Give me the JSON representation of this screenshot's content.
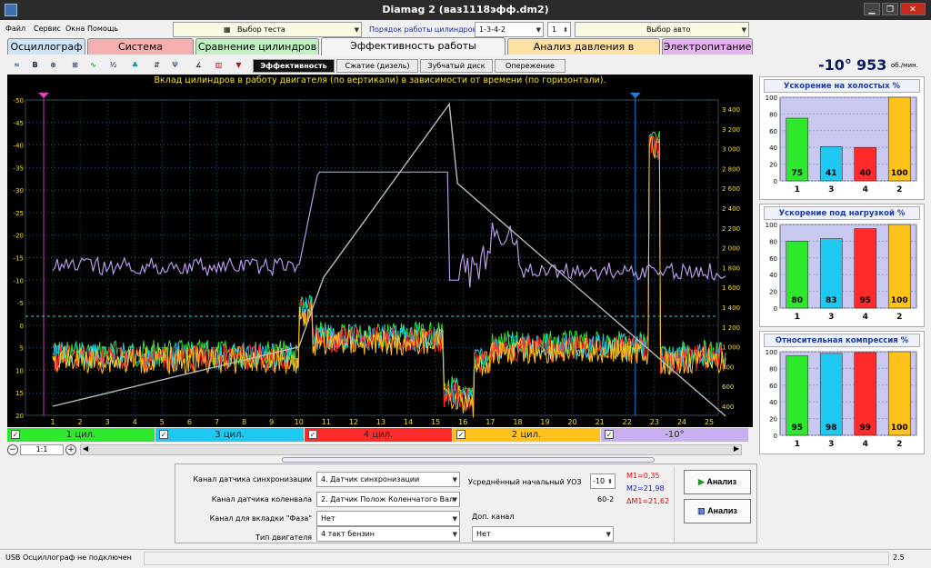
{
  "window": {
    "title": "Diamag 2 (ваз1118эфф.dm2)"
  },
  "menu": [
    "Файл",
    "Сервис",
    "Окна",
    "Помощь"
  ],
  "toolbar_top": {
    "test_select": "Выбор теста",
    "cyl_order_label": "Порядок работы цилиндров",
    "cyl_order_value": "1-3-4-2",
    "cyl_num": "1",
    "auto_select": "Выбор авто"
  },
  "tabs": [
    {
      "label": "Осциллограф",
      "color": "#cfe3f7"
    },
    {
      "label": "Система зажигания",
      "color": "#f7b0b0"
    },
    {
      "label": "Сравнение цилиндров",
      "color": "#bff0bf"
    },
    {
      "label": "Эффективность работы цилиндров",
      "color": "#f4f4f4"
    },
    {
      "label": "Анализ давления в цилиндре",
      "color": "#fde1a3"
    },
    {
      "label": "Электропитание",
      "color": "#e6b3f0"
    }
  ],
  "subtabs": [
    "Эффективность",
    "Сжатие (дизель)",
    "Зубчатый диск",
    "Опережение"
  ],
  "engine": {
    "angle": "-10°",
    "rpm": "953",
    "rpm_unit": "об./мин."
  },
  "chart_data": {
    "type": "line",
    "title": "Вклад цилиндров в работу двигателя (по вертикали) в зависимости от времени (по горизонтали).",
    "x_ticks": [
      "1",
      "2",
      "3",
      "4",
      "5",
      "6",
      "7",
      "8",
      "9",
      "10",
      "11",
      "12",
      "13",
      "14",
      "15",
      "16",
      "17",
      "18",
      "19",
      "20",
      "21",
      "22",
      "23",
      "24",
      "25"
    ],
    "y_left_ticks": [
      "-50",
      "-45",
      "-40",
      "-35",
      "-30",
      "-25",
      "-20",
      "-15",
      "-10",
      "-5",
      "0",
      "5",
      "10",
      "15",
      "20"
    ],
    "y_right_ticks": [
      "3 400",
      "3 200",
      "3 000",
      "2 800",
      "2 600",
      "2 400",
      "2 200",
      "2 000",
      "1 800",
      "1 600",
      "1 400",
      "1 200",
      "1 000",
      "800",
      "600",
      "400"
    ],
    "series": [
      {
        "name": "1 цил.",
        "color": "#2ee82e"
      },
      {
        "name": "3 цил.",
        "color": "#1ec8f0"
      },
      {
        "name": "4 цил.",
        "color": "#ff2a2a"
      },
      {
        "name": "2 цил.",
        "color": "#ffc21a"
      },
      {
        "name": "-10°",
        "color": "#b89ae8"
      }
    ],
    "rpm_curve": {
      "x": [
        1,
        10,
        10.9,
        15.5,
        15.8,
        25.6
      ],
      "y": [
        400,
        1000,
        1700,
        3450,
        2650,
        300
      ]
    }
  },
  "channels": [
    {
      "label": "1 цил.",
      "color": "#2ee82e"
    },
    {
      "label": "3 цил.",
      "color": "#1ec8f0"
    },
    {
      "label": "4 цил.",
      "color": "#ff2a2a"
    },
    {
      "label": "2 цил.",
      "color": "#ffc21a"
    },
    {
      "label": "-10°",
      "color": "#c9aef0"
    }
  ],
  "scale": "1:1",
  "panels": [
    {
      "title": "Ускорение на холостых %",
      "values": [
        75,
        41,
        40,
        100
      ],
      "labels": [
        "1",
        "3",
        "4",
        "2"
      ]
    },
    {
      "title": "Ускорение под нагрузкой %",
      "values": [
        80,
        83,
        95,
        100
      ],
      "labels": [
        "1",
        "3",
        "4",
        "2"
      ]
    },
    {
      "title": "Относительная компрессия %",
      "values": [
        95,
        98,
        99,
        100
      ],
      "labels": [
        "1",
        "3",
        "4",
        "2"
      ]
    }
  ],
  "panel_axis": [
    "100",
    "80",
    "60",
    "40",
    "20",
    "0"
  ],
  "bar_colors": [
    "#2ee82e",
    "#1ec8f0",
    "#ff2a2a",
    "#ffc21a"
  ],
  "bottom": {
    "sync_label": "Канал датчика синхронизации",
    "sync_value": "4.  Датчик синхронизации",
    "crank_label": "Канал датчика коленвала",
    "crank_value": "2.  Датчик Полож Коленчатого Вал",
    "phase_label": "Канал для вкладки \"Фаза\"",
    "phase_value": "Нет",
    "engine_label": "Тип двигателя",
    "engine_value": "4 такт бензин",
    "uoz_label": "Усреднённый начальный УОЗ",
    "uoz_value": "-10",
    "wheel": "60-2",
    "m1": "M1=0,35",
    "m2": "M2=21,98",
    "dm1": "ΔM1=21,62",
    "extra_label": "Доп. канал",
    "extra_value": "Нет",
    "analyze1": "Анализ",
    "analyze2": "Анализ"
  },
  "status": {
    "left": "USB Осциллограф не подключен",
    "right": "2.5"
  }
}
